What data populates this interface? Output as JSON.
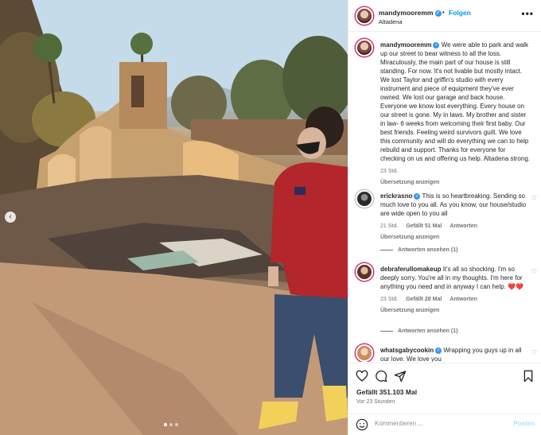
{
  "post": {
    "username": "mandymooremm",
    "separator": "•",
    "follow_label": "Folgen",
    "location": "Altadena",
    "more_icon": "more-horizontal-icon"
  },
  "caption": {
    "username": "mandymooremm",
    "text": "We were able to park and walk up our street to bear witness to all the loss. Miraculously, the main part of our house is still standing. For now. It's not livable but mostly intact. We lost Taylor and griffin's studio with every instrument and piece of equipment they've ever owned. We lost our garage and back house. Everyone we know lost everything. Every house on our street is gone. My in laws. My brother and sister in law- 6 weeks from welcoming their first baby. Our best friends. Feeling weird survivors guilt. We love this community and will do everything we can to help rebuild and support. Thanks for everyone for checking on us and offering us help. Altadena strong.",
    "time": "23 Std.",
    "translate": "Übersetzung anzeigen"
  },
  "comments": [
    {
      "username": "erickrasno",
      "text": "This is so heartbreaking. Sending so much love to you all. As you know, our house/studio are wide open to you all",
      "time": "21 Std.",
      "likes": "Gefällt 51 Mal",
      "reply": "Antworten",
      "translate": "Übersetzung anzeigen",
      "replies": "Antworten ansehen (1)"
    },
    {
      "username": "debraferullomakeup",
      "text": "It's all so shocking. I'm so deeply sorry. You're all in my thoughts. I'm here for anything you need and in anyway I can help. ❤️❤️",
      "time": "23 Std.",
      "likes": "Gefällt 28 Mal",
      "reply": "Antworten",
      "translate": "Übersetzung anzeigen",
      "replies": "Antworten ansehen (1)"
    },
    {
      "username": "whatsgabycookin",
      "text": "Wrapping you guys up in all our love. We love you"
    }
  ],
  "footer": {
    "likes": "Gefällt 351.103 Mal",
    "posted": "Vor 23 Stunden",
    "comment_placeholder": "Kommentieren ...",
    "post_label": "Posten"
  },
  "colors": {
    "accent": "#0095f6",
    "verified": "#3897f0",
    "post_disabled": "#b2dffc"
  }
}
